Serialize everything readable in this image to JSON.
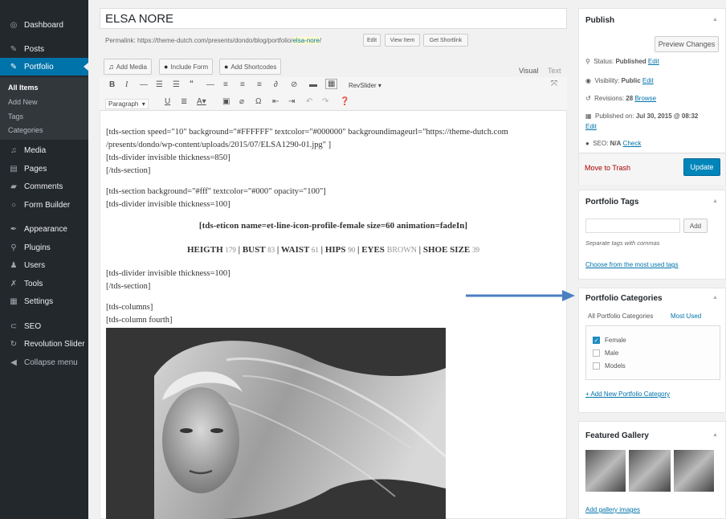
{
  "sidebar": {
    "items": [
      {
        "label": "Dashboard",
        "icon": "dashboard-icon",
        "glyph": "◎"
      },
      {
        "label": "Posts",
        "icon": "pin-icon",
        "glyph": "✎"
      },
      {
        "label": "Portfolio",
        "icon": "pin-icon",
        "glyph": "✎"
      },
      {
        "label": "Media",
        "icon": "media-icon",
        "glyph": "♫"
      },
      {
        "label": "Pages",
        "icon": "pages-icon",
        "glyph": "▤"
      },
      {
        "label": "Comments",
        "icon": "comments-icon",
        "glyph": "▰"
      },
      {
        "label": "Form Builder",
        "icon": "form-builder-icon",
        "glyph": "○"
      },
      {
        "label": "Appearance",
        "icon": "appearance-icon",
        "glyph": "✒"
      },
      {
        "label": "Plugins",
        "icon": "plugins-icon",
        "glyph": "⚲"
      },
      {
        "label": "Users",
        "icon": "users-icon",
        "glyph": "♟"
      },
      {
        "label": "Tools",
        "icon": "tools-icon",
        "glyph": "✗"
      },
      {
        "label": "Settings",
        "icon": "settings-icon",
        "glyph": "▦"
      },
      {
        "label": "SEO",
        "icon": "seo-icon",
        "glyph": "⊂"
      },
      {
        "label": "Revolution Slider",
        "icon": "refresh-icon",
        "glyph": "↻"
      },
      {
        "label": "Collapse menu",
        "icon": "collapse-icon",
        "glyph": "◀"
      }
    ],
    "submenu": [
      "All Items",
      "Add New",
      "Tags",
      "Categories"
    ]
  },
  "editor": {
    "title": "ELSA NORE",
    "permalink_label": "Permalink:",
    "permalink_base": "https://theme-dutch.com/presents/dondo/blog/portfolio/",
    "permalink_slug": "elsa-nore",
    "permalink_end": "/",
    "edit_btn": "Edit",
    "view_btn": "View Item",
    "shortlink_btn": "Get Shortlink",
    "add_media": "Add Media",
    "include_form": "Include Form",
    "add_shortcodes": "Add Shortcodes",
    "tab_visual": "Visual",
    "tab_text": "Text",
    "paragraph_select": "Paragraph",
    "revslider": "RevSlider",
    "content": {
      "l1": "[tds-section speed=\"10\" background=\"#FFFFFF\" textcolor=\"#000000\" backgroundimageurl=\"https://theme-dutch.com",
      "l2": "/presents/dondo/wp-content/uploads/2015/07/ELSA1290-01.jpg\" ]",
      "l3": "[tds-divider invisible thickness=850]",
      "l4": "[/tds-section]",
      "l5": "[tds-section background=\"#fff\" textcolor=\"#000\" opacity=\"100\"]",
      "l6": "[tds-divider invisible thickness=100]",
      "icon_line": "[tds-eticon name=et-line-icon-profile-female size=60 animation=fadeIn]",
      "stats": {
        "heigth_label": "HEIGTH",
        "heigth_val": "179",
        "bust_label": "BUST",
        "bust_val": "83",
        "waist_label": "WAIST",
        "waist_val": "61",
        "hips_label": "HIPS",
        "hips_val": "90",
        "eyes_label": "EYES",
        "eyes_val": "BROWN",
        "shoe_label": "SHOE SIZE",
        "shoe_val": "39",
        "sep": "|"
      },
      "l7": "[tds-divider invisible thickness=100]",
      "l8": "[/tds-section]",
      "l9": "[tds-columns]",
      "l10": "[tds-column fourth]"
    }
  },
  "publish": {
    "title": "Publish",
    "preview": "Preview Changes",
    "status_label": "Status:",
    "status_value": "Published",
    "visibility_label": "Visibility:",
    "visibility_value": "Public",
    "revisions_label": "Revisions:",
    "revisions_value": "28",
    "published_label": "Published on:",
    "published_value": "Jul 30, 2015 @ 08:32",
    "seo_label": "SEO:",
    "seo_value": "N/A",
    "edit_link": "Edit",
    "browse_link": "Browse",
    "check_link": "Check",
    "trash": "Move to Trash",
    "update": "Update"
  },
  "portfolio_tags": {
    "title": "Portfolio Tags",
    "add": "Add",
    "help": "Separate tags with commas",
    "choose": "Choose from the most used tags"
  },
  "portfolio_categories": {
    "title": "Portfolio Categories",
    "tab_all": "All Portfolio Categories",
    "tab_most": "Most Used",
    "items": [
      {
        "label": "Female",
        "checked": true
      },
      {
        "label": "Male",
        "checked": false
      },
      {
        "label": "Models",
        "checked": false
      }
    ],
    "add_new": "+ Add New Portfolio Category"
  },
  "featured_gallery": {
    "title": "Featured Gallery",
    "add": "Add gallery images"
  },
  "colors": {
    "sidebar_bg": "#23282d",
    "accent": "#0073aa",
    "update_btn": "#0085ba",
    "arrow": "#4a7fc1"
  }
}
